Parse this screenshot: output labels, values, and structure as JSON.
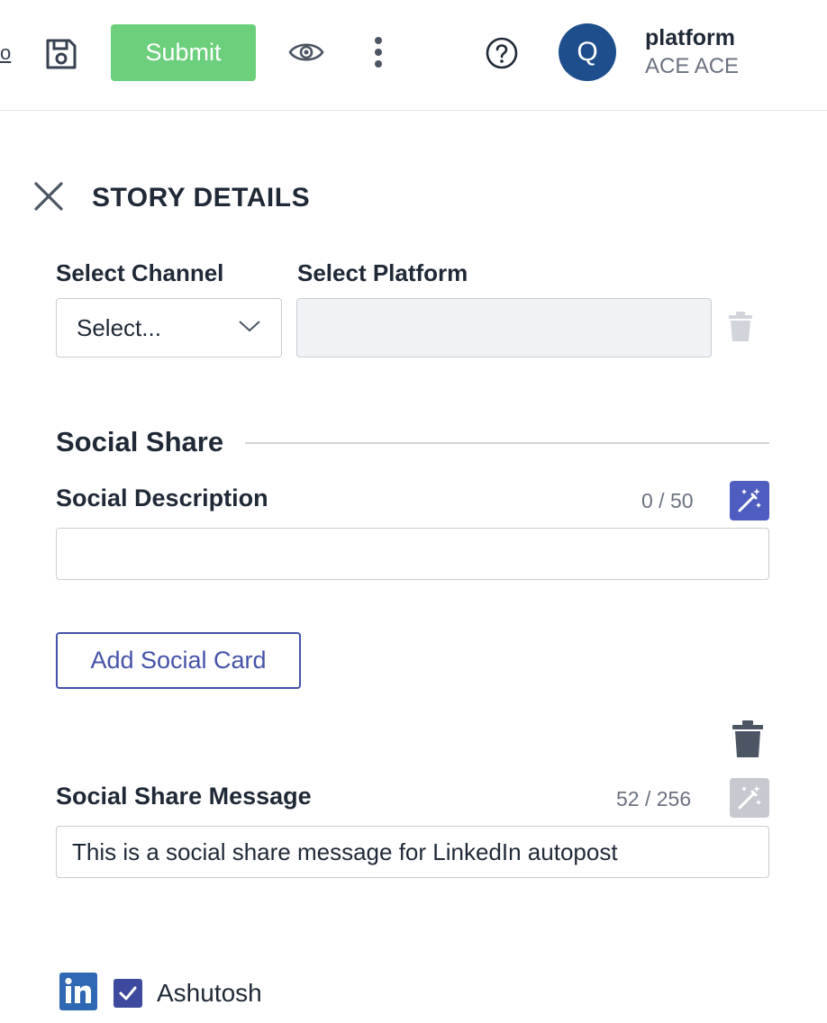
{
  "topbar": {
    "cut_link_text": "o",
    "submit_label": "Submit",
    "user": {
      "avatar_initial": "Q",
      "name": "platform",
      "org": "ACE ACE"
    },
    "icons": [
      "save-icon",
      "eye-icon",
      "more-vertical-icon",
      "help-icon"
    ]
  },
  "panel": {
    "title": "STORY DETAILS",
    "close_icon": "close-icon"
  },
  "channel": {
    "channel_label": "Select Channel",
    "platform_label": "Select Platform",
    "channel_value": "Select...",
    "platform_value": ""
  },
  "social_share": {
    "section_title": "Social Share",
    "description": {
      "label": "Social Description",
      "counter": "0 / 50",
      "value": ""
    },
    "add_card_label": "Add Social Card",
    "message": {
      "label": "Social Share Message",
      "counter": "52 / 256",
      "value": "This is a social share message for LinkedIn autopost"
    },
    "account": {
      "network": "linkedin",
      "name": "Ashutosh",
      "checked": true
    }
  },
  "colors": {
    "submit_green": "#6ccf7b",
    "avatar_blue": "#1e4e8c",
    "ai_button": "#4f5cc0",
    "accent_indigo": "#4452a8",
    "linkedin_blue": "#2e67b2"
  }
}
